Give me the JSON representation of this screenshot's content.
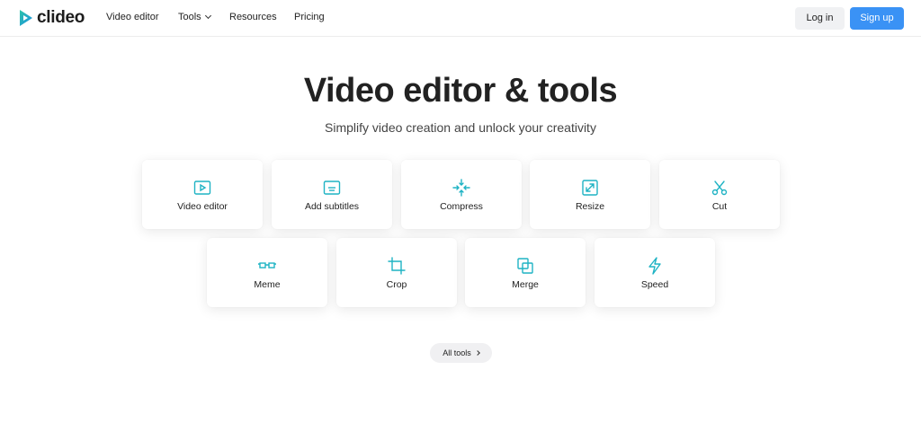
{
  "header": {
    "logo_text": "clideo",
    "nav": {
      "video_editor": "Video editor",
      "tools": "Tools",
      "resources": "Resources",
      "pricing": "Pricing"
    },
    "login": "Log in",
    "signup": "Sign up"
  },
  "hero": {
    "title": "Video editor & tools",
    "subtitle": "Simplify video creation and unlock your creativity"
  },
  "tools": [
    {
      "label": "Video editor",
      "icon": "video-play-icon"
    },
    {
      "label": "Add subtitles",
      "icon": "subtitles-icon"
    },
    {
      "label": "Compress",
      "icon": "compress-icon"
    },
    {
      "label": "Resize",
      "icon": "resize-icon"
    },
    {
      "label": "Cut",
      "icon": "scissors-icon"
    },
    {
      "label": "Meme",
      "icon": "meme-glasses-icon"
    },
    {
      "label": "Crop",
      "icon": "crop-icon"
    },
    {
      "label": "Merge",
      "icon": "merge-icon"
    },
    {
      "label": "Speed",
      "icon": "lightning-icon"
    }
  ],
  "all_tools": "All tools",
  "colors": {
    "accent": "#1fb3c4",
    "signup": "#3a92f5"
  }
}
